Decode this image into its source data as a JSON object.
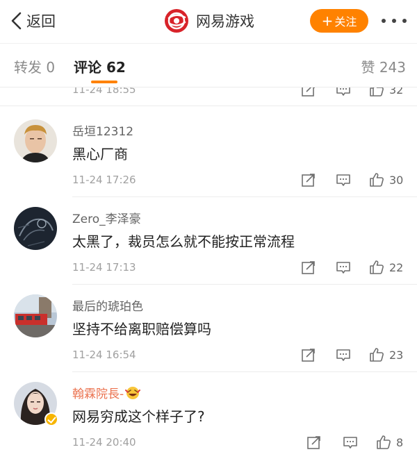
{
  "header": {
    "back_label": "返回",
    "title": "网易游戏",
    "follow_label": "关注",
    "follow_plus": "+"
  },
  "tabs": {
    "repost": "转发 0",
    "comment": "评论 62",
    "like": "赞 243"
  },
  "colors": {
    "accent": "#ff8200",
    "vip_name": "#eb7350",
    "verify": "#f7b500"
  },
  "partial_comment": {
    "time": "11-24 18:55",
    "likes": "32"
  },
  "comments": [
    {
      "name": "岳垣12312",
      "text": "黑心厂商",
      "time": "11-24 17:26",
      "likes": "30",
      "avatar": "avatar-photo-young-man"
    },
    {
      "name": "Zero_李泽豪",
      "text": "太黑了，裁员怎么就不能按正常流程",
      "time": "11-24 17:13",
      "likes": "22",
      "avatar": "avatar-dark-sketch"
    },
    {
      "name": "最后的琥珀色",
      "text": "坚持不给离职赔偿算吗",
      "time": "11-24 16:54",
      "likes": "23",
      "avatar": "avatar-street-tram"
    },
    {
      "name": "翰霖院長-",
      "text": "网易穷成这个样子了?",
      "time": "11-24 20:40",
      "likes": "8",
      "avatar": "avatar-woman-portrait",
      "verified": true,
      "badge": "laughing-emoji"
    }
  ],
  "icons": {
    "back": "chevron-left-icon",
    "logo": "netease-logo",
    "more": "more-dots-icon",
    "repost": "repost-icon",
    "comment": "comment-icon",
    "like": "thumb-up-icon",
    "verify": "verified-badge-icon"
  }
}
